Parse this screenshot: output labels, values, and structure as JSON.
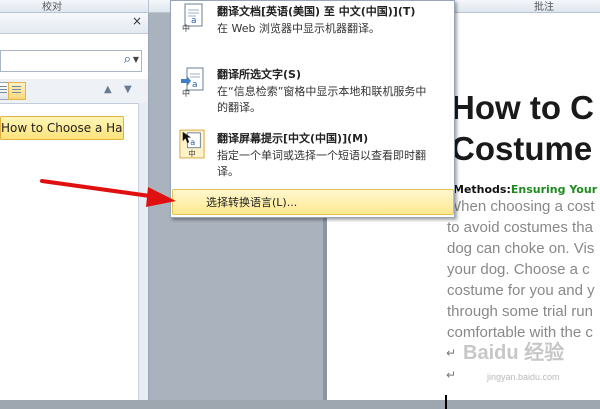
{
  "ribbon": {
    "group_review": "校对",
    "group_comments": "批注"
  },
  "nav_pane": {
    "close_glyph": "×",
    "search_placeholder": "",
    "heading_item": "How to Choose a Hall..."
  },
  "menu": {
    "items": [
      {
        "title": "翻译文档[英语(美国) 至 中文(中国)](T)",
        "desc": "在 Web 浏览器中显示机器翻译。"
      },
      {
        "title": "翻译所选文字(S)",
        "desc": "在“信息检索”窗格中显示本地和联机服务中的翻译。"
      },
      {
        "title": "翻译屏幕提示[中文(中国)](M)",
        "desc": "指定一个单词或选择一个短语以查看即时翻译。"
      }
    ],
    "selected_item": "选择转换语言(L)..."
  },
  "document": {
    "title_line1": "How to C",
    "title_line2": "Costume",
    "methods_label": "Methods:",
    "methods_link1": "Ensuring",
    "methods_link2": "Your D",
    "body_lines": [
      "When choosing a cost",
      "to avoid costumes tha",
      "dog can choke on. Vis",
      "your dog. Choose a c",
      "costume for you and y",
      "through some trial run",
      "comfortable with the c"
    ],
    "para_mark": "↵"
  },
  "watermark": {
    "text": "Baidu 经验",
    "url": "jingyan.baidu.com"
  },
  "colors": {
    "highlight": "#fde98f",
    "arrow": "#e01010",
    "link_green": "#1e8a1e"
  }
}
